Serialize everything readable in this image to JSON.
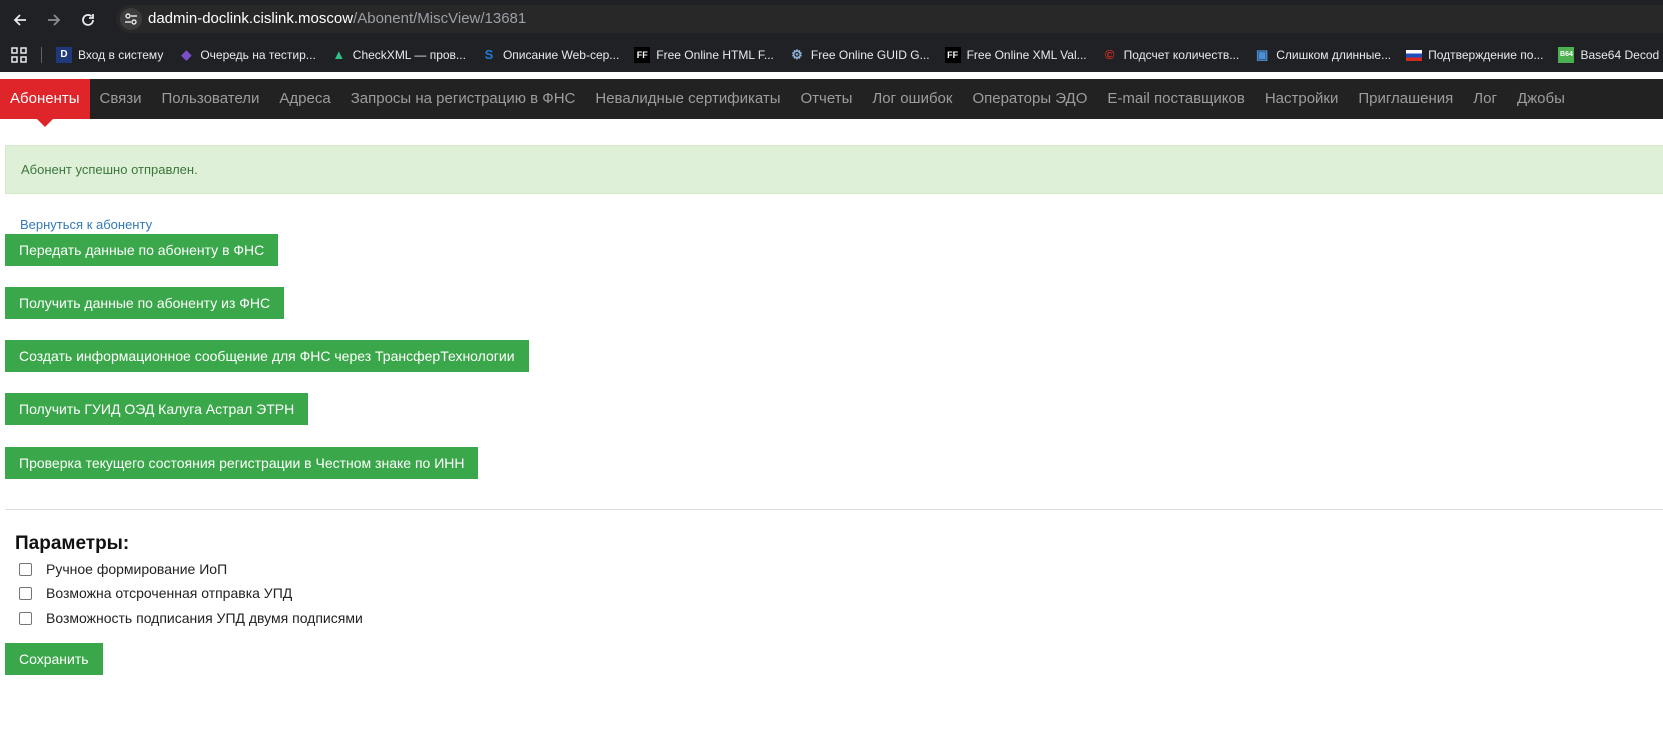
{
  "browser": {
    "url_host": "dadmin-doclink.cislink.moscow",
    "url_path": "/Abonent/MiscView/13681",
    "bookmarks": [
      {
        "label": "Вход в систему",
        "icon": "d-icon",
        "color": "#1f5fbf"
      },
      {
        "label": "Очередь на тестир...",
        "icon": "visual-studio-icon",
        "color": "#7b4fc9"
      },
      {
        "label": "CheckXML — пров...",
        "icon": "checkxml-icon",
        "color": "#2dbf8a"
      },
      {
        "label": "Описание Web-сер...",
        "icon": "web-service-icon",
        "color": "#1f7ad8"
      },
      {
        "label": "Free Online HTML F...",
        "icon": "ff-icon",
        "color": "#000000"
      },
      {
        "label": "Free Online GUID G...",
        "icon": "gears-icon",
        "color": "#8fb3d9"
      },
      {
        "label": "Free Online XML Val...",
        "icon": "ff-icon",
        "color": "#000000"
      },
      {
        "label": "Подсчет количеств...",
        "icon": "copyright-icon",
        "color": "#d93025"
      },
      {
        "label": "Слишком длинные...",
        "icon": "window-icon",
        "color": "#4a90d9"
      },
      {
        "label": "Подтверждение по...",
        "icon": "russia-flag-icon",
        "color": "#d52b1e"
      },
      {
        "label": "Base64 Decod",
        "icon": "b64-icon",
        "color": "#4caf50"
      }
    ]
  },
  "nav": {
    "items": [
      {
        "label": "Абоненты",
        "active": true
      },
      {
        "label": "Связи",
        "active": false
      },
      {
        "label": "Пользователи",
        "active": false
      },
      {
        "label": "Адреса",
        "active": false
      },
      {
        "label": "Запросы на регистрацию в ФНС",
        "active": false
      },
      {
        "label": "Невалидные сертификаты",
        "active": false
      },
      {
        "label": "Отчеты",
        "active": false
      },
      {
        "label": "Лог ошибок",
        "active": false
      },
      {
        "label": "Операторы ЭДО",
        "active": false
      },
      {
        "label": "E-mail поставщиков",
        "active": false
      },
      {
        "label": "Настройки",
        "active": false
      },
      {
        "label": "Приглашения",
        "active": false
      },
      {
        "label": "Лог",
        "active": false
      },
      {
        "label": "Джобы",
        "active": false
      }
    ]
  },
  "alert": {
    "text": "Абонент успешно отправлен."
  },
  "back_link": "Вернуться к абоненту",
  "actions": [
    "Передать данные по абоненту в ФНС",
    "Получить данные по абоненту из ФНС",
    "Создать информационное сообщение для ФНС через ТрансферТехнологии",
    "Получить ГУИД ОЭД Калуга Астрал ЭТРН",
    "Проверка текущего состояния регистрации в Честном знаке по ИНН"
  ],
  "params": {
    "title": "Параметры:",
    "options": [
      {
        "label": "Ручное формирование ИоП",
        "checked": false
      },
      {
        "label": "Возможна отсроченная отправка УПД",
        "checked": false
      },
      {
        "label": "Возможность подписания УПД двумя подписями",
        "checked": false
      }
    ],
    "save_label": "Сохранить"
  },
  "colors": {
    "accent_red": "#e0252a",
    "button_green": "#3aa84a",
    "alert_bg": "#dff0d8",
    "alert_text": "#3c763d",
    "link_blue": "#337ab7"
  }
}
